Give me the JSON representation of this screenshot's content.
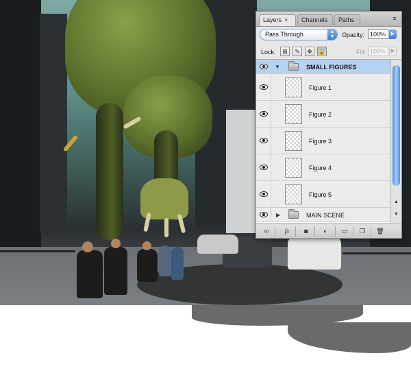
{
  "panel": {
    "tabs": [
      {
        "label": "Layers",
        "close": "×",
        "active": true
      },
      {
        "label": "Channels",
        "active": false
      },
      {
        "label": "Paths",
        "active": false
      }
    ],
    "menu_icon": "≡",
    "blend_mode": "Pass Through",
    "opacity_label": "Opacity:",
    "opacity_value": "100%",
    "lock_label": "Lock:",
    "fill_label": "Fill:",
    "fill_value": "100%",
    "layers": {
      "group": {
        "name": "SMALL FIGURES",
        "expanded": true,
        "visible": true,
        "selected": true
      },
      "children": [
        {
          "name": "Figure 1",
          "visible": true
        },
        {
          "name": "Figure 2",
          "visible": true
        },
        {
          "name": "Figure 3",
          "visible": true
        },
        {
          "name": "Figure 4",
          "visible": true
        },
        {
          "name": "Figure 5",
          "visible": true
        }
      ],
      "main_group": {
        "name": "MAIN SCENE",
        "expanded": false,
        "visible": true
      }
    },
    "footer_buttons": [
      "link-layers-icon",
      "fx-icon",
      "layer-mask-icon",
      "adjustment-layer-icon",
      "new-group-icon",
      "new-layer-icon",
      "trash-icon"
    ],
    "fx_label": "fx"
  },
  "colors": {
    "selection": "#b6d2f2",
    "accent": "#3d7ed3"
  }
}
